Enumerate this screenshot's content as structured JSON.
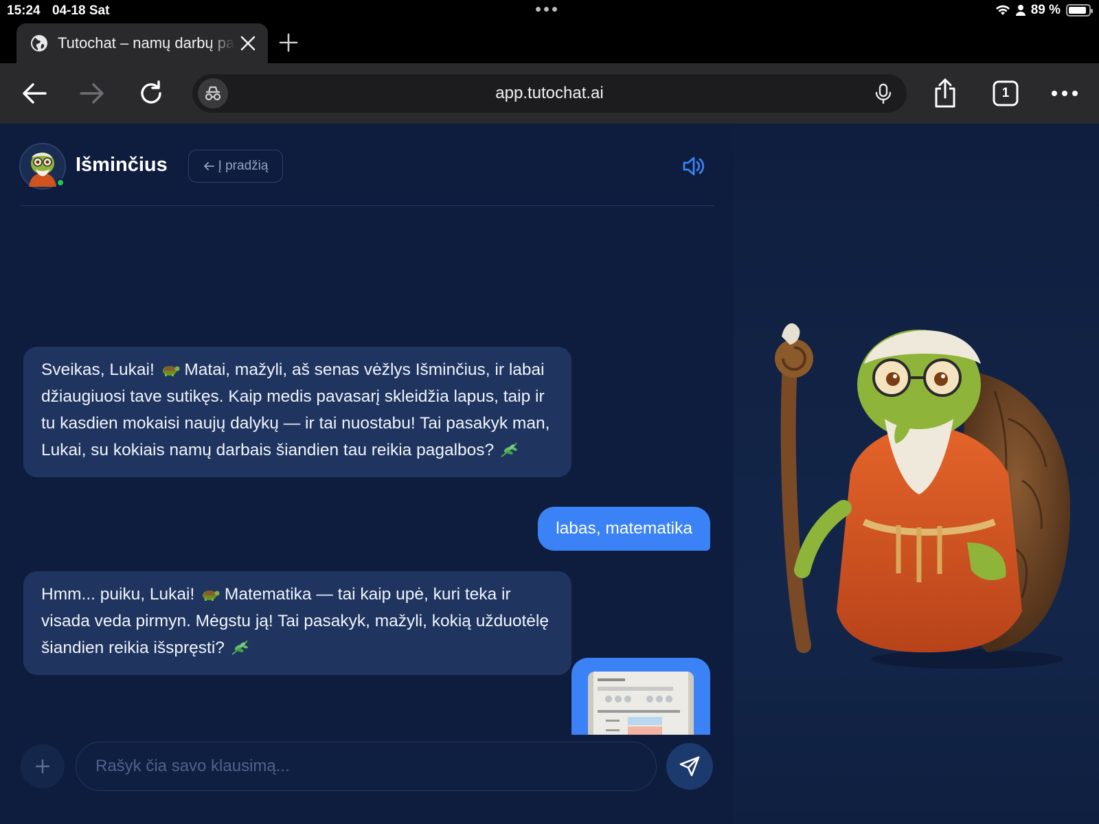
{
  "status": {
    "time": "15:24",
    "date": "04-18 Sat",
    "battery": "89 %",
    "battery_level": 0.89
  },
  "browser": {
    "tab_title": "Tutochat – namų darbų pagalbininkas",
    "url": "app.tutochat.ai",
    "tab_count": "1"
  },
  "chat": {
    "bot_name": "Išminčius",
    "home_label": "Į pradžią",
    "messages": [
      {
        "role": "bot",
        "text_a": "Sveikas, Lukai! ",
        "emoji_a": "turtle",
        "text_b": " Matai, mažyli, aš senas vėžlys Išminčius, ir labai džiaugiuosi tave sutikęs. Kaip medis pavasarį skleidžia lapus, taip ir tu kasdien mokaisi naujų dalykų — ir tai nuostabu! Tai pasakyk man, Lukai, su kokiais namų darbais šiandien tau reikia pagalbos? ",
        "emoji_b": "herb"
      },
      {
        "role": "user",
        "text": "labas, matematika"
      },
      {
        "role": "bot",
        "text_a": "Hmm... puiku, Lukai! ",
        "emoji_a": "turtle",
        "text_b": " Matematika — tai kaip upė, kuri teka ir visada veda pirmyn. Mėgstu ją! Tai pasakyk, mažyli, kokią užduotėlę šiandien reikia išspręsti? ",
        "emoji_b": "herb"
      },
      {
        "role": "user",
        "type": "image"
      }
    ],
    "input_placeholder": "Rašyk čia savo klausimą..."
  },
  "colors": {
    "bg": "#0e1d3d",
    "bot_bubble": "#1f3560",
    "user_bubble": "#3b82f6",
    "accent": "#3b82f6"
  }
}
